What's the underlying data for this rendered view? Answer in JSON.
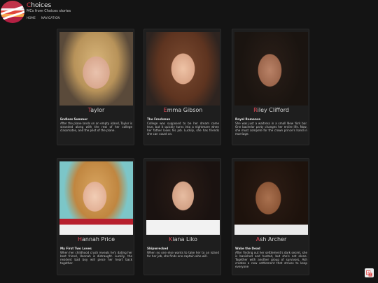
{
  "header": {
    "title_first": "C",
    "title_rest": "hoices",
    "subtitle": "MCs from Choices stories",
    "nav": [
      "HOME",
      "NAVIGATION"
    ]
  },
  "cards": [
    {
      "name_first": "T",
      "name_rest": "aylor",
      "story": "Endless Summer",
      "desc": "After the plane lands on an empty island, Taylor is stranded along with the rest of her college classmates, and the pilot of the plane."
    },
    {
      "name_first": "E",
      "name_rest": "mma Gibson",
      "story": "The Freshman",
      "desc": "College was supposed to be her dream come true, but it quickly turns into a nightmare when her father loses his job. Luckily, she has friends she can count on."
    },
    {
      "name_first": "R",
      "name_rest": "iley Clifford",
      "story": "Royal Romance",
      "desc": "She was just a waitress in a small New York bar. One bachelor party changes her entire life. Now, she must compete for the crown prince's hand in marriage."
    },
    {
      "name_first": "H",
      "name_rest": "annah Price",
      "story": "My First Two Loves",
      "desc": "When her childhood crush reveals he's dating her best friend, Hannah is distraught. Luckily, the resident bad boy will piece her heart back together."
    },
    {
      "name_first": "K",
      "name_rest": "iana Liko",
      "story": "Shipwrecked",
      "desc": "When no one else wants to take her to an island for her job, she finds one captain who will."
    },
    {
      "name_first": "A",
      "name_rest": "sh Archer",
      "story": "Wake the Dead",
      "desc": "After finding out her settlement's dark secret, she is banished and hunted, but she's not alone. Together with another group of survivors, Ash creates a new settlement that strives to keep everyone"
    }
  ],
  "colors": {
    "accent": "#e04a58",
    "background": "#141414",
    "card": "#1e1e1e"
  },
  "icons": {
    "translate": "translate-icon"
  }
}
